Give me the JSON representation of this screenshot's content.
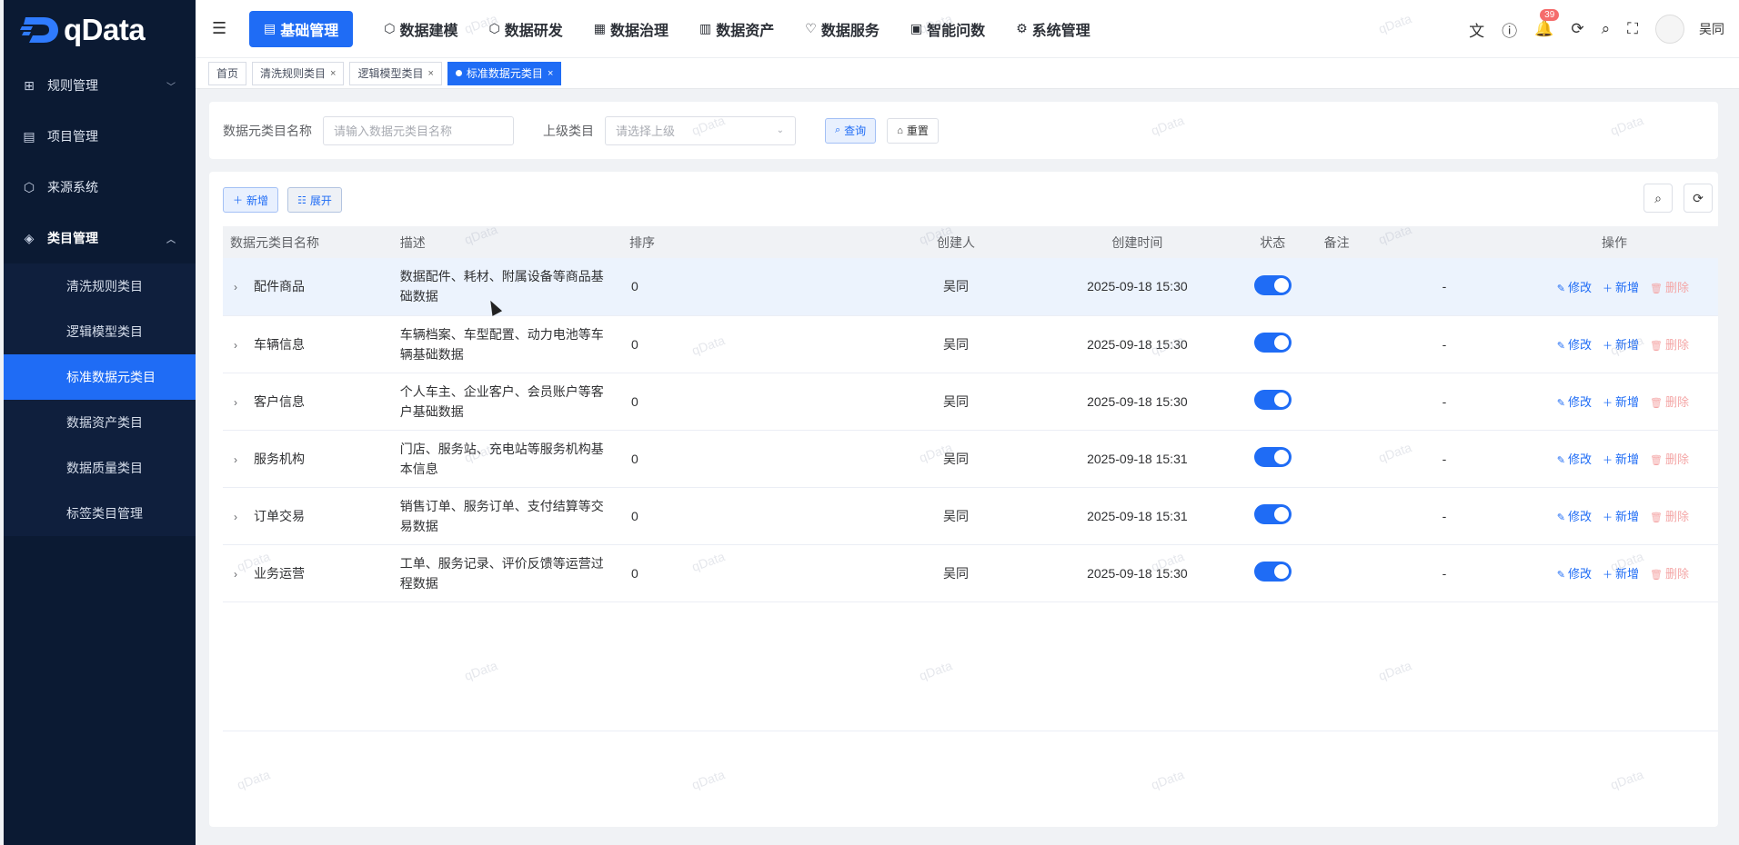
{
  "app": {
    "logo_text": "qData"
  },
  "sidebar": {
    "items": [
      {
        "label": "规则管理",
        "icon": "grid-icon",
        "expanded": false
      },
      {
        "label": "项目管理",
        "icon": "document-icon",
        "expanded": false
      },
      {
        "label": "来源系统",
        "icon": "cube-icon",
        "expanded": false
      },
      {
        "label": "类目管理",
        "icon": "layers-icon",
        "expanded": true
      }
    ],
    "sub_items": [
      {
        "label": "清洗规则类目",
        "active": false
      },
      {
        "label": "逻辑模型类目",
        "active": false
      },
      {
        "label": "标准数据元类目",
        "active": true
      },
      {
        "label": "数据资产类目",
        "active": false
      },
      {
        "label": "数据质量类目",
        "active": false
      },
      {
        "label": "标签类目管理",
        "active": false
      }
    ]
  },
  "topnav": {
    "items": [
      {
        "label": "基础管理",
        "active": true
      },
      {
        "label": "数据建模",
        "active": false
      },
      {
        "label": "数据研发",
        "active": false
      },
      {
        "label": "数据治理",
        "active": false
      },
      {
        "label": "数据资产",
        "active": false
      },
      {
        "label": "数据服务",
        "active": false
      },
      {
        "label": "智能问数",
        "active": false
      },
      {
        "label": "系统管理",
        "active": false
      }
    ],
    "notification_count": "39",
    "username": "吴同"
  },
  "tags": [
    {
      "label": "首页",
      "closable": false,
      "active": false
    },
    {
      "label": "清洗规则类目",
      "closable": true,
      "active": false
    },
    {
      "label": "逻辑模型类目",
      "closable": true,
      "active": false
    },
    {
      "label": "标准数据元类目",
      "closable": true,
      "active": true
    }
  ],
  "search": {
    "name_label": "数据元类目名称",
    "name_placeholder": "请输入数据元类目名称",
    "parent_label": "上级类目",
    "parent_placeholder": "请选择上级",
    "query_label": "查询",
    "reset_label": "重置"
  },
  "toolbar": {
    "add_label": "新增",
    "expand_label": "展开"
  },
  "table": {
    "headers": [
      "数据元类目名称",
      "描述",
      "排序",
      "创建人",
      "创建时间",
      "状态",
      "备注",
      "操作"
    ],
    "op_labels": {
      "edit": "修改",
      "add": "新增",
      "delete": "删除"
    },
    "rows": [
      {
        "name": "配件商品",
        "desc": "数据配件、耗材、附属设备等商品基础数据",
        "sort": "0",
        "creator": "吴同",
        "time": "2025-09-18 15:30",
        "status": true,
        "remark": "-"
      },
      {
        "name": "车辆信息",
        "desc": "车辆档案、车型配置、动力电池等车辆基础数据",
        "sort": "0",
        "creator": "吴同",
        "time": "2025-09-18 15:30",
        "status": true,
        "remark": "-"
      },
      {
        "name": "客户信息",
        "desc": "个人车主、企业客户、会员账户等客户基础数据",
        "sort": "0",
        "creator": "吴同",
        "time": "2025-09-18 15:30",
        "status": true,
        "remark": "-"
      },
      {
        "name": "服务机构",
        "desc": "门店、服务站、充电站等服务机构基本信息",
        "sort": "0",
        "creator": "吴同",
        "time": "2025-09-18 15:31",
        "status": true,
        "remark": "-"
      },
      {
        "name": "订单交易",
        "desc": "销售订单、服务订单、支付结算等交易数据",
        "sort": "0",
        "creator": "吴同",
        "time": "2025-09-18 15:31",
        "status": true,
        "remark": "-"
      },
      {
        "name": "业务运营",
        "desc": "工单、服务记录、评价反馈等运营过程数据",
        "sort": "0",
        "creator": "吴同",
        "time": "2025-09-18 15:30",
        "status": true,
        "remark": "-"
      }
    ]
  },
  "watermark_text": "qData"
}
